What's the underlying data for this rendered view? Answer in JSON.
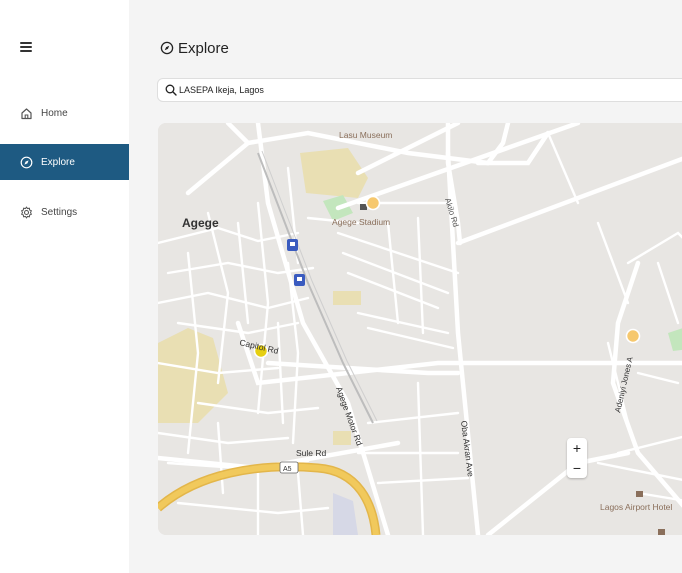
{
  "app": {
    "title": "Explore"
  },
  "sidebar": {
    "menu_icon": "hamburger-menu-icon",
    "items": [
      {
        "label": "Home",
        "icon": "home-icon",
        "active": false
      },
      {
        "label": "Explore",
        "icon": "compass-icon",
        "active": true
      },
      {
        "label": "Settings",
        "icon": "gear-icon",
        "active": false
      }
    ]
  },
  "header": {
    "icon": "compass-icon",
    "title": "Explore"
  },
  "search": {
    "icon": "search-icon",
    "value": "LASEPA Ikeja, Lagos"
  },
  "map": {
    "labels": {
      "lasu_museum": "Lasu Museum",
      "agege": "Agege",
      "agege_stadium": "Agege Stadium",
      "akilo_rd": "Akilo Rd",
      "capitol_rd": "Capitol Rd",
      "agege_motor_rd": "Agege Motor Rd",
      "sule_rd": "Sule Rd",
      "a5": "A5",
      "oba_akran_ave": "Oba Akran Ave",
      "adeniyi_jones": "Adeniyi Jones A",
      "lagos_airport_hotel": "Lagos Airport Hotel"
    },
    "markers": [
      {
        "name": "marker-agege-stadium",
        "color": "#f6c86e"
      },
      {
        "name": "marker-capitol-rd",
        "color": "#e6cf10"
      },
      {
        "name": "marker-adeniyi-jones",
        "color": "#f6c86e"
      }
    ],
    "zoom_in": "+",
    "zoom_out": "−",
    "colors": {
      "land": "#e8e6e3",
      "road": "#ffffff",
      "highway": "#f1c95c",
      "park": "#c3e6bd",
      "sand": "#e9dfb3",
      "transit": "#3a5bbf"
    }
  }
}
